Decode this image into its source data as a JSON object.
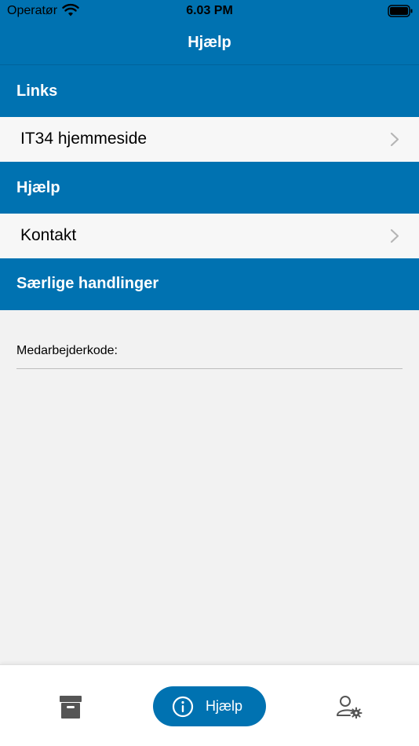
{
  "status_bar": {
    "carrier": "Operatør",
    "time": "6.03 PM"
  },
  "nav": {
    "title": "Hjælp"
  },
  "sections": [
    {
      "title": "Links",
      "items": [
        {
          "label": "IT34 hjemmeside"
        }
      ]
    },
    {
      "title": "Hjælp",
      "items": [
        {
          "label": "Kontakt"
        }
      ]
    },
    {
      "title": "Særlige handlinger"
    }
  ],
  "form": {
    "employee_code_label": "Medarbejderkode:",
    "employee_code_value": ""
  },
  "tab_bar": {
    "tabs": [
      {
        "icon": "archive-icon",
        "label": ""
      },
      {
        "icon": "info-icon",
        "label": "Hjælp",
        "active": true
      },
      {
        "icon": "user-settings-icon",
        "label": ""
      }
    ]
  },
  "colors": {
    "brand": "#0072b1",
    "background": "#f2f2f2"
  }
}
